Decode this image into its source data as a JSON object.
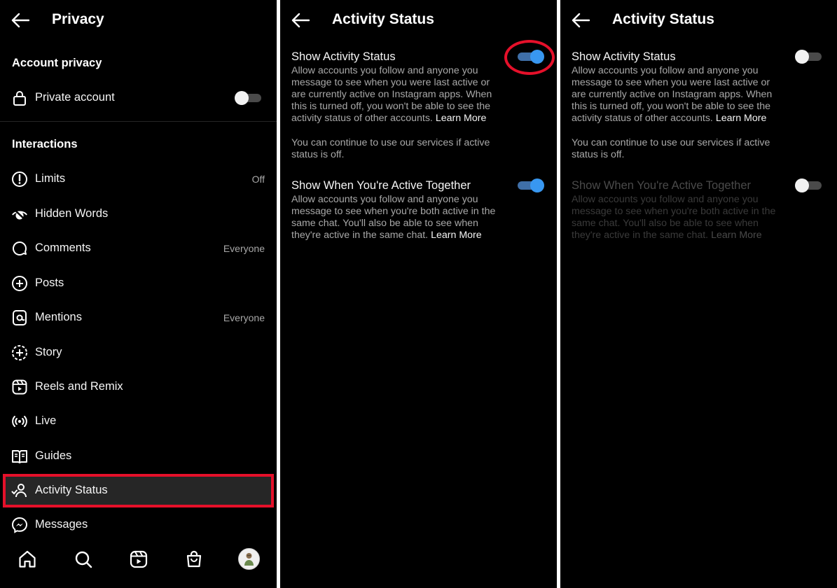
{
  "privacy_screen": {
    "title": "Privacy",
    "account_section": "Account privacy",
    "private_account_label": "Private account",
    "interactions_section": "Interactions",
    "items": [
      {
        "label": "Limits",
        "value": "Off",
        "icon": "limits-icon"
      },
      {
        "label": "Hidden Words",
        "value": "",
        "icon": "hidden-words-icon"
      },
      {
        "label": "Comments",
        "value": "Everyone",
        "icon": "comment-icon"
      },
      {
        "label": "Posts",
        "value": "",
        "icon": "plus-square-icon"
      },
      {
        "label": "Mentions",
        "value": "Everyone",
        "icon": "at-sign-icon"
      },
      {
        "label": "Story",
        "value": "",
        "icon": "story-plus-icon"
      },
      {
        "label": "Reels and Remix",
        "value": "",
        "icon": "reels-icon"
      },
      {
        "label": "Live",
        "value": "",
        "icon": "live-broadcast-icon"
      },
      {
        "label": "Guides",
        "value": "",
        "icon": "guides-book-icon"
      },
      {
        "label": "Activity Status",
        "value": "",
        "icon": "activity-status-icon"
      },
      {
        "label": "Messages",
        "value": "",
        "icon": "messenger-icon"
      }
    ],
    "bottom_nav": [
      "home-icon",
      "search-icon",
      "reels-icon",
      "shop-icon",
      "profile-avatar"
    ]
  },
  "activity_on": {
    "title": "Activity Status",
    "show_status_title": "Show Activity Status",
    "show_status_desc": "Allow accounts you follow and anyone you message to see when you were last active or are currently active on Instagram apps. When this is turned off, you won't be able to see the activity status of other accounts.",
    "learn_more": "Learn More",
    "note": "You can continue to use our services if active status is off.",
    "together_title": "Show When You're Active Together",
    "together_desc": "Allow accounts you follow and anyone you message to see when you're both active in the same chat. You'll also be able to see when they're active in the same chat.",
    "show_status_toggle": "on",
    "together_toggle": "on"
  },
  "activity_off": {
    "title": "Activity Status",
    "show_status_title": "Show Activity Status",
    "show_status_desc": "Allow accounts you follow and anyone you message to see when you were last active or are currently active on Instagram apps. When this is turned off, you won't be able to see the activity status of other accounts.",
    "learn_more": "Learn More",
    "note": "You can continue to use our services if active status is off.",
    "together_title": "Show When You're Active Together",
    "together_desc": "Allow accounts you follow and anyone you message to see when you're both active in the same chat. You'll also be able to see when they're active in the same chat.",
    "show_status_toggle": "off",
    "together_toggle": "off"
  },
  "colors": {
    "background": "#000000",
    "highlight": "#e5102a",
    "toggle_on": "#3897f0",
    "secondary_text": "#a8a8a8"
  }
}
